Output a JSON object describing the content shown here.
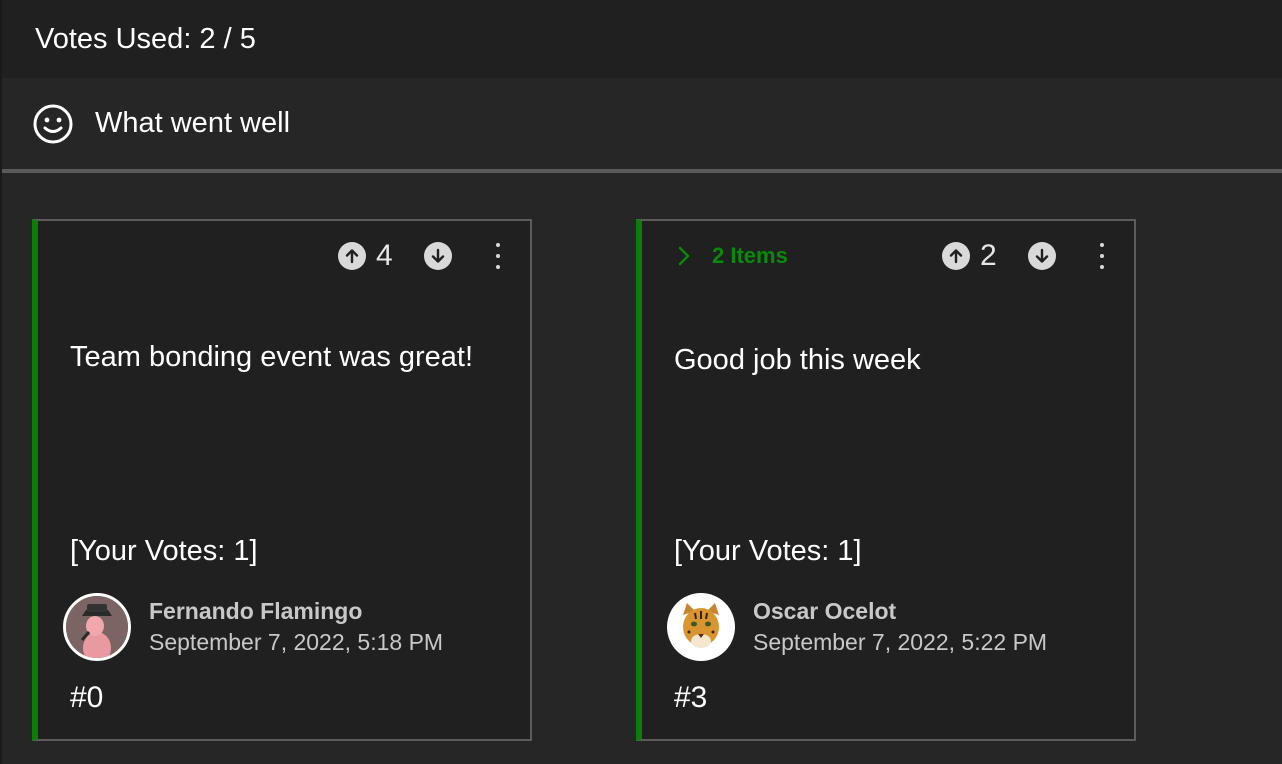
{
  "header": {
    "votes_used": "Votes Used: 2 / 5"
  },
  "column": {
    "title": "What went well",
    "icon": "smiley-icon"
  },
  "cards": [
    {
      "upvote_count": "4",
      "text": "Team bonding event was great!",
      "your_votes": "[Your Votes: 1]",
      "author_name": "Fernando Flamingo",
      "date": "September 7, 2022, 5:18 PM",
      "id": "#0",
      "avatar": "flamingo-avatar"
    },
    {
      "items_label": "2 Items",
      "upvote_count": "2",
      "text": "Good job this week",
      "your_votes": "[Your Votes: 1]",
      "author_name": "Oscar Ocelot",
      "date": "September 7, 2022, 5:22 PM",
      "id": "#3",
      "avatar": "ocelot-avatar"
    }
  ],
  "colors": {
    "accent_green": "#0a7d0a",
    "background": "#262626",
    "card": "#202020"
  }
}
